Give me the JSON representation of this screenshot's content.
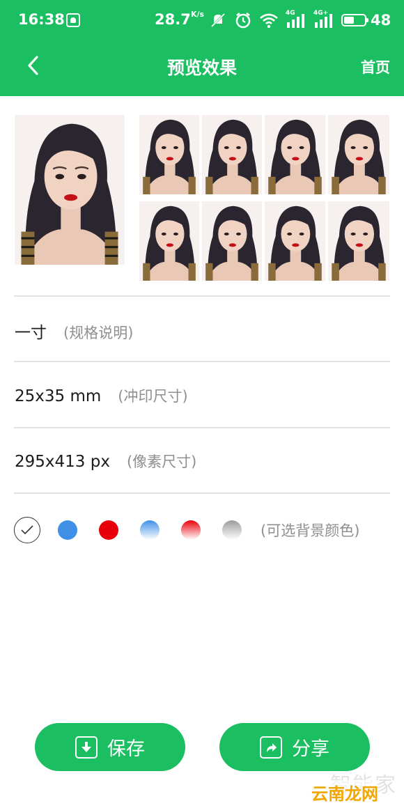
{
  "status_bar": {
    "time": "16:38",
    "speed": "28.7",
    "speed_unit": "K/s",
    "network_1": "4G",
    "network_2": "4G+",
    "battery": "48"
  },
  "header": {
    "title": "预览效果",
    "home_label": "首页",
    "back_icon": "chevron-left-icon"
  },
  "photos": {
    "large_count": 1,
    "small_count": 8,
    "background": "#f6f1ee"
  },
  "specs": {
    "name": "一寸",
    "name_hint": "(规格说明)",
    "print_size": "25x35 mm",
    "print_size_hint": "(冲印尺寸)",
    "pixel_size": "295x413 px",
    "pixel_size_hint": "(像素尺寸)"
  },
  "background_colors": {
    "hint": "(可选背景颜色)",
    "options": [
      {
        "name": "white",
        "color": "#ffffff",
        "selected": true
      },
      {
        "name": "blue",
        "color": "#3f8fe6"
      },
      {
        "name": "red",
        "color": "#e8000b"
      },
      {
        "name": "blue-gradient",
        "color": "#3f8fe6"
      },
      {
        "name": "red-gradient",
        "color": "#e8000b"
      },
      {
        "name": "gray-gradient",
        "color": "#9b9b9b"
      }
    ]
  },
  "actions": {
    "save_label": "保存",
    "share_label": "分享"
  },
  "watermark": {
    "text_1": "智能家",
    "text_2": "云南龙网"
  },
  "theme": {
    "accent": "#1bbf61"
  }
}
